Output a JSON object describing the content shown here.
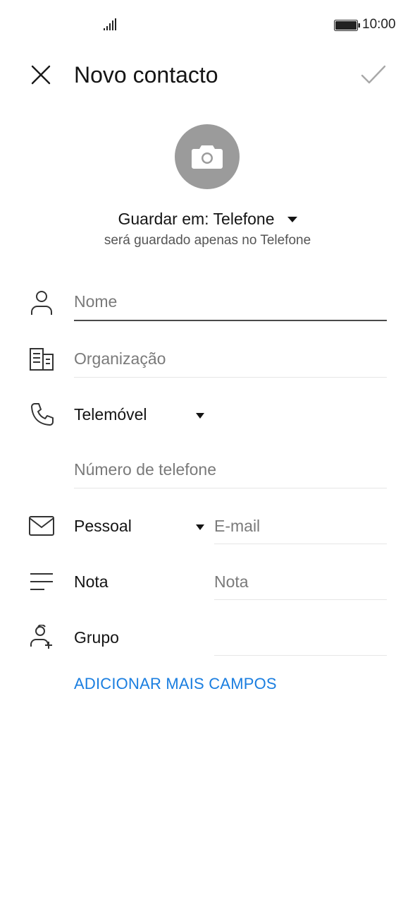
{
  "status_bar": {
    "time": "10:00",
    "signal_icon": "signal-bars-icon",
    "battery_icon": "battery-icon"
  },
  "header": {
    "title": "Novo contacto",
    "close_icon": "close-icon",
    "confirm_icon": "checkmark-icon"
  },
  "avatar": {
    "icon": "camera-icon"
  },
  "storage": {
    "label": "Guardar em: Telefone",
    "subtitle": "será guardado apenas no Telefone"
  },
  "fields": {
    "name": {
      "placeholder": "Nome",
      "icon": "person-icon"
    },
    "organization": {
      "placeholder": "Organização",
      "icon": "organization-icon"
    },
    "phone": {
      "type_label": "Telemóvel",
      "placeholder": "Número de telefone",
      "icon": "phone-icon"
    },
    "email": {
      "type_label": "Pessoal",
      "placeholder": "E-mail",
      "icon": "mail-icon"
    },
    "note": {
      "label": "Nota",
      "placeholder": "Nota",
      "icon": "note-lines-icon"
    },
    "group": {
      "label": "Grupo",
      "value": "",
      "icon": "group-add-icon"
    }
  },
  "add_more_label": "ADICIONAR MAIS CAMPOS",
  "colors": {
    "accent": "#1a7ee0",
    "avatar_bg": "#9b9b9b"
  }
}
